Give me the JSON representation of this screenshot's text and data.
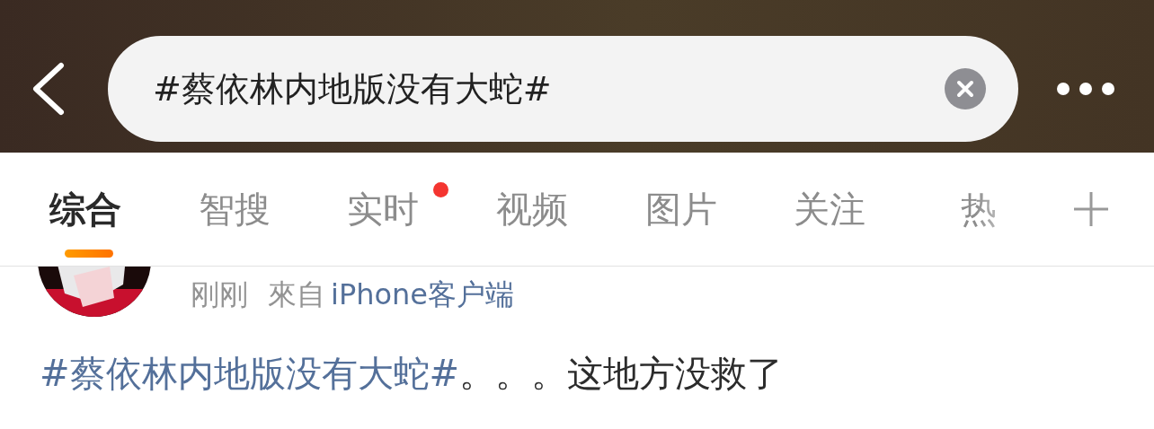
{
  "search": {
    "value": "#蔡依林内地版没有大蛇#"
  },
  "tabs": [
    {
      "label": "综合",
      "selected": true,
      "dot": false
    },
    {
      "label": "智搜",
      "selected": false,
      "dot": false
    },
    {
      "label": "实时",
      "selected": false,
      "dot": true
    },
    {
      "label": "视频",
      "selected": false,
      "dot": false
    },
    {
      "label": "图片",
      "selected": false,
      "dot": false
    },
    {
      "label": "关注",
      "selected": false,
      "dot": false
    },
    {
      "label": "热",
      "selected": false,
      "dot": false
    }
  ],
  "post": {
    "time": "刚刚",
    "source_prefix": "來自",
    "source": "iPhone客户端",
    "hashtag": "#蔡依林内地版没有大蛇#",
    "text": "。。。这地方没救了"
  }
}
